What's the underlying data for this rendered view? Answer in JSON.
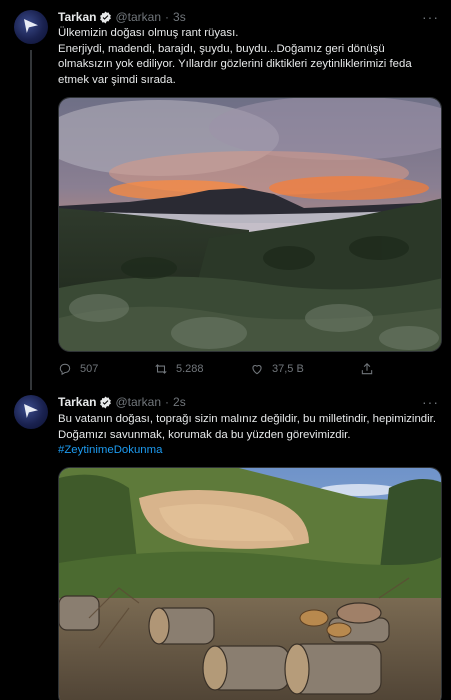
{
  "tweet1": {
    "author_name": "Tarkan",
    "handle": "@tarkan",
    "time": "3s",
    "text_line1": "Ülkemizin doğası olmuş rant rüyası.",
    "text_line2": "Enerjiydi, madendi, barajdı, şuydu, buydu...Doğamız geri dönüşü olmaksızın yok ediliyor. Yıllardır gözlerini diktikleri zeytinliklerimizi feda etmek var şimdi sırada.",
    "replies": "507",
    "retweets": "5.288",
    "likes": "37,5 B"
  },
  "tweet2": {
    "author_name": "Tarkan",
    "handle": "@tarkan",
    "time": "2s",
    "text_line1": "Bu vatanın doğası, toprağı sizin malınız değildir, bu milletindir, hepimizindir.",
    "text_line2": "Doğamızı savunmak, korumak da bu yüzden görevimizdir.",
    "hashtag": "#ZeytinimeDokunma"
  },
  "separator": "·",
  "more_glyph": "···"
}
